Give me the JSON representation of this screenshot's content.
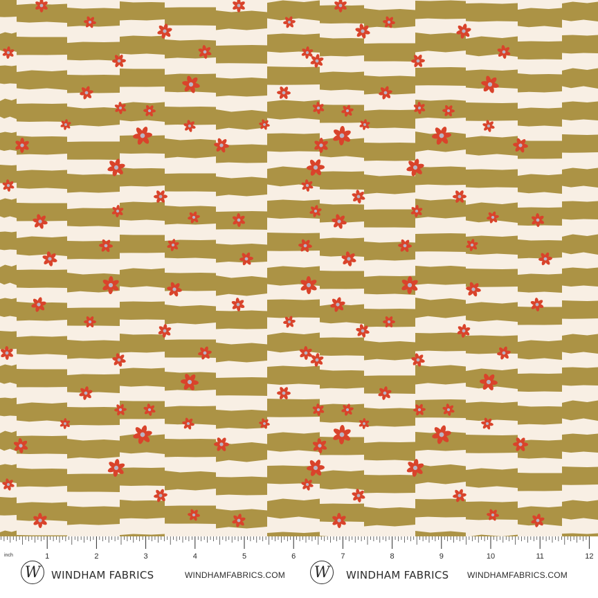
{
  "pattern": {
    "colors": {
      "stripe_dark": "#ac9345",
      "stripe_light": "#f8efe4",
      "flower_petal": "#d9432b",
      "flower_center": "#b8b4c4"
    }
  },
  "ruler": {
    "unit_label": "inch",
    "numbers": [
      "1",
      "2",
      "3",
      "4",
      "5",
      "6",
      "7",
      "8",
      "9",
      "10",
      "11",
      "12"
    ]
  },
  "branding": [
    {
      "logo_letter": "W",
      "name": "WINDHAM FABRICS",
      "url": "WINDHAMFABRICS.COM",
      "logo_icon": "windham-w-logo-icon"
    },
    {
      "logo_letter": "W",
      "name": "WINDHAM FABRICS",
      "url": "WINDHAMFABRICS.COM",
      "logo_icon": "windham-w-logo-icon"
    }
  ]
}
